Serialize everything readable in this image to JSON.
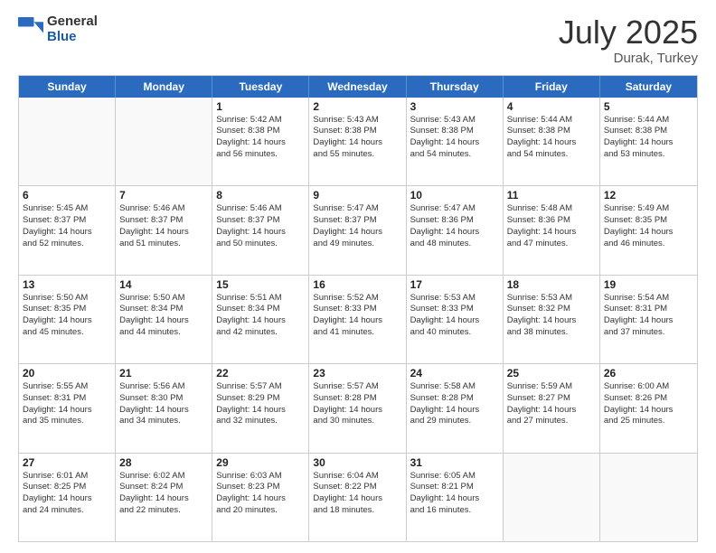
{
  "header": {
    "logo_general": "General",
    "logo_blue": "Blue",
    "month_year": "July 2025",
    "location": "Durak, Turkey"
  },
  "days_of_week": [
    "Sunday",
    "Monday",
    "Tuesday",
    "Wednesday",
    "Thursday",
    "Friday",
    "Saturday"
  ],
  "weeks": [
    [
      {
        "day": "",
        "empty": true
      },
      {
        "day": "",
        "empty": true
      },
      {
        "day": "1",
        "lines": [
          "Sunrise: 5:42 AM",
          "Sunset: 8:38 PM",
          "Daylight: 14 hours",
          "and 56 minutes."
        ]
      },
      {
        "day": "2",
        "lines": [
          "Sunrise: 5:43 AM",
          "Sunset: 8:38 PM",
          "Daylight: 14 hours",
          "and 55 minutes."
        ]
      },
      {
        "day": "3",
        "lines": [
          "Sunrise: 5:43 AM",
          "Sunset: 8:38 PM",
          "Daylight: 14 hours",
          "and 54 minutes."
        ]
      },
      {
        "day": "4",
        "lines": [
          "Sunrise: 5:44 AM",
          "Sunset: 8:38 PM",
          "Daylight: 14 hours",
          "and 54 minutes."
        ]
      },
      {
        "day": "5",
        "lines": [
          "Sunrise: 5:44 AM",
          "Sunset: 8:38 PM",
          "Daylight: 14 hours",
          "and 53 minutes."
        ]
      }
    ],
    [
      {
        "day": "6",
        "lines": [
          "Sunrise: 5:45 AM",
          "Sunset: 8:37 PM",
          "Daylight: 14 hours",
          "and 52 minutes."
        ]
      },
      {
        "day": "7",
        "lines": [
          "Sunrise: 5:46 AM",
          "Sunset: 8:37 PM",
          "Daylight: 14 hours",
          "and 51 minutes."
        ]
      },
      {
        "day": "8",
        "lines": [
          "Sunrise: 5:46 AM",
          "Sunset: 8:37 PM",
          "Daylight: 14 hours",
          "and 50 minutes."
        ]
      },
      {
        "day": "9",
        "lines": [
          "Sunrise: 5:47 AM",
          "Sunset: 8:37 PM",
          "Daylight: 14 hours",
          "and 49 minutes."
        ]
      },
      {
        "day": "10",
        "lines": [
          "Sunrise: 5:47 AM",
          "Sunset: 8:36 PM",
          "Daylight: 14 hours",
          "and 48 minutes."
        ]
      },
      {
        "day": "11",
        "lines": [
          "Sunrise: 5:48 AM",
          "Sunset: 8:36 PM",
          "Daylight: 14 hours",
          "and 47 minutes."
        ]
      },
      {
        "day": "12",
        "lines": [
          "Sunrise: 5:49 AM",
          "Sunset: 8:35 PM",
          "Daylight: 14 hours",
          "and 46 minutes."
        ]
      }
    ],
    [
      {
        "day": "13",
        "lines": [
          "Sunrise: 5:50 AM",
          "Sunset: 8:35 PM",
          "Daylight: 14 hours",
          "and 45 minutes."
        ]
      },
      {
        "day": "14",
        "lines": [
          "Sunrise: 5:50 AM",
          "Sunset: 8:34 PM",
          "Daylight: 14 hours",
          "and 44 minutes."
        ]
      },
      {
        "day": "15",
        "lines": [
          "Sunrise: 5:51 AM",
          "Sunset: 8:34 PM",
          "Daylight: 14 hours",
          "and 42 minutes."
        ]
      },
      {
        "day": "16",
        "lines": [
          "Sunrise: 5:52 AM",
          "Sunset: 8:33 PM",
          "Daylight: 14 hours",
          "and 41 minutes."
        ]
      },
      {
        "day": "17",
        "lines": [
          "Sunrise: 5:53 AM",
          "Sunset: 8:33 PM",
          "Daylight: 14 hours",
          "and 40 minutes."
        ]
      },
      {
        "day": "18",
        "lines": [
          "Sunrise: 5:53 AM",
          "Sunset: 8:32 PM",
          "Daylight: 14 hours",
          "and 38 minutes."
        ]
      },
      {
        "day": "19",
        "lines": [
          "Sunrise: 5:54 AM",
          "Sunset: 8:31 PM",
          "Daylight: 14 hours",
          "and 37 minutes."
        ]
      }
    ],
    [
      {
        "day": "20",
        "lines": [
          "Sunrise: 5:55 AM",
          "Sunset: 8:31 PM",
          "Daylight: 14 hours",
          "and 35 minutes."
        ]
      },
      {
        "day": "21",
        "lines": [
          "Sunrise: 5:56 AM",
          "Sunset: 8:30 PM",
          "Daylight: 14 hours",
          "and 34 minutes."
        ]
      },
      {
        "day": "22",
        "lines": [
          "Sunrise: 5:57 AM",
          "Sunset: 8:29 PM",
          "Daylight: 14 hours",
          "and 32 minutes."
        ]
      },
      {
        "day": "23",
        "lines": [
          "Sunrise: 5:57 AM",
          "Sunset: 8:28 PM",
          "Daylight: 14 hours",
          "and 30 minutes."
        ]
      },
      {
        "day": "24",
        "lines": [
          "Sunrise: 5:58 AM",
          "Sunset: 8:28 PM",
          "Daylight: 14 hours",
          "and 29 minutes."
        ]
      },
      {
        "day": "25",
        "lines": [
          "Sunrise: 5:59 AM",
          "Sunset: 8:27 PM",
          "Daylight: 14 hours",
          "and 27 minutes."
        ]
      },
      {
        "day": "26",
        "lines": [
          "Sunrise: 6:00 AM",
          "Sunset: 8:26 PM",
          "Daylight: 14 hours",
          "and 25 minutes."
        ]
      }
    ],
    [
      {
        "day": "27",
        "lines": [
          "Sunrise: 6:01 AM",
          "Sunset: 8:25 PM",
          "Daylight: 14 hours",
          "and 24 minutes."
        ]
      },
      {
        "day": "28",
        "lines": [
          "Sunrise: 6:02 AM",
          "Sunset: 8:24 PM",
          "Daylight: 14 hours",
          "and 22 minutes."
        ]
      },
      {
        "day": "29",
        "lines": [
          "Sunrise: 6:03 AM",
          "Sunset: 8:23 PM",
          "Daylight: 14 hours",
          "and 20 minutes."
        ]
      },
      {
        "day": "30",
        "lines": [
          "Sunrise: 6:04 AM",
          "Sunset: 8:22 PM",
          "Daylight: 14 hours",
          "and 18 minutes."
        ]
      },
      {
        "day": "31",
        "lines": [
          "Sunrise: 6:05 AM",
          "Sunset: 8:21 PM",
          "Daylight: 14 hours",
          "and 16 minutes."
        ]
      },
      {
        "day": "",
        "empty": true
      },
      {
        "day": "",
        "empty": true
      }
    ]
  ]
}
